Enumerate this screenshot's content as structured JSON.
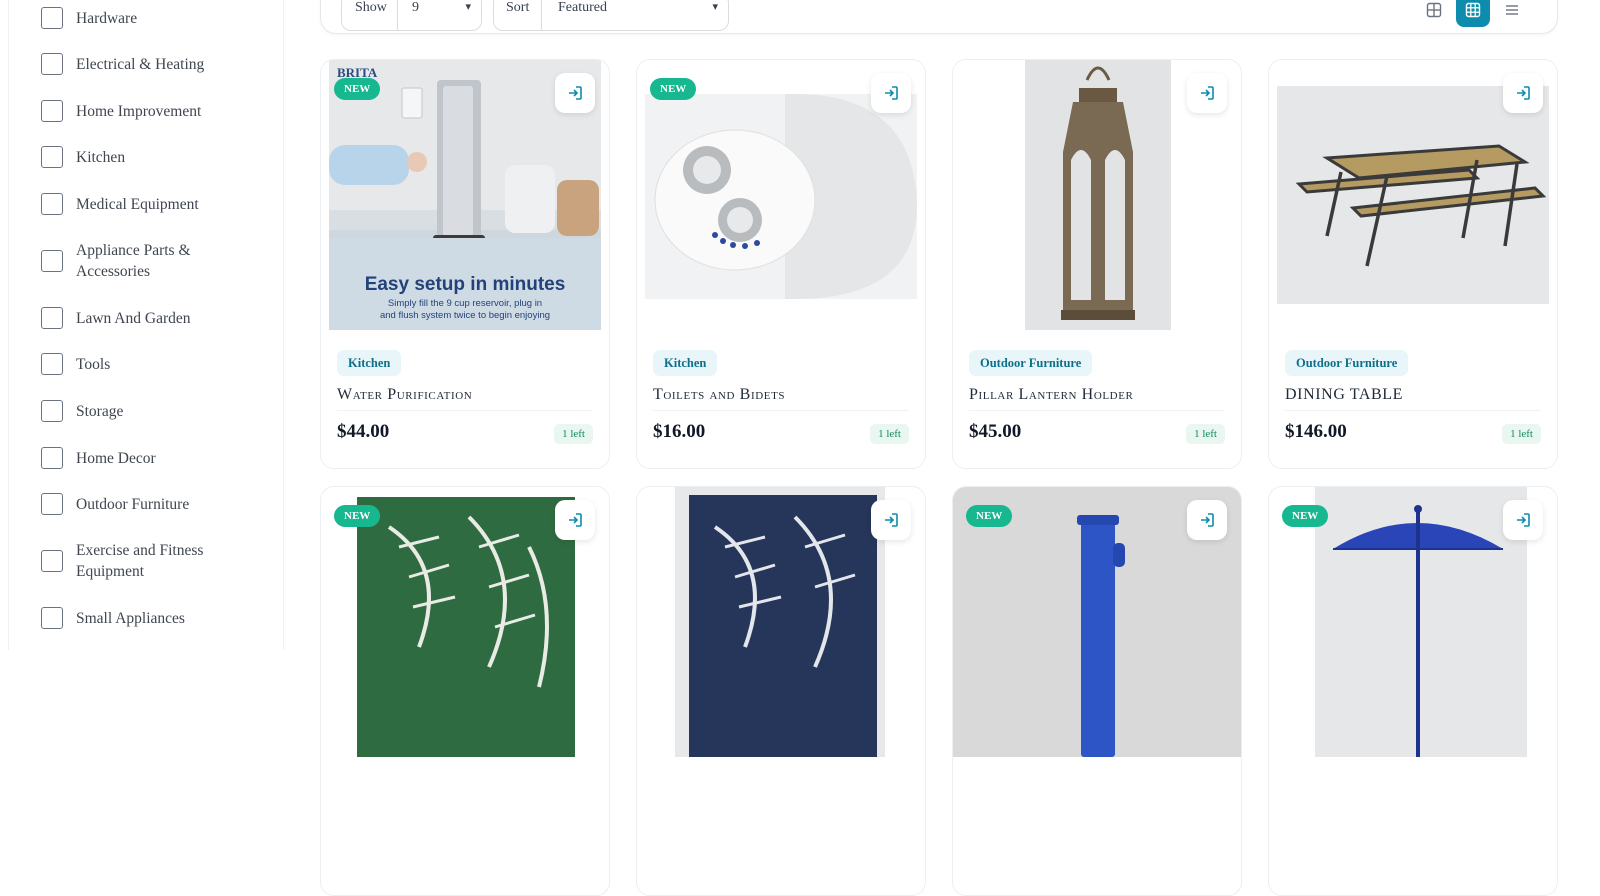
{
  "sidebar": {
    "categories": [
      {
        "label": "Hardware"
      },
      {
        "label": "Electrical & Heating"
      },
      {
        "label": "Home Improvement"
      },
      {
        "label": "Kitchen"
      },
      {
        "label": "Medical Equipment"
      },
      {
        "label": "Appliance Parts & Accessories"
      },
      {
        "label": "Lawn And Garden"
      },
      {
        "label": "Tools"
      },
      {
        "label": "Storage"
      },
      {
        "label": "Home Decor"
      },
      {
        "label": "Outdoor Furniture"
      },
      {
        "label": "Exercise and Fitness Equipment"
      },
      {
        "label": "Small Appliances"
      }
    ]
  },
  "toolbar": {
    "show_label": "Show",
    "show_value": "9",
    "sort_label": "Sort",
    "sort_value": "Featured"
  },
  "products": [
    {
      "badge": "NEW",
      "category": "Kitchen",
      "name": "Water Purification",
      "price": "$44.00",
      "stock": "1 left",
      "image_brand": "BRITA",
      "image_headline": "Easy setup in minutes",
      "image_sub1": "Simply fill the 9 cup reservoir, plug in",
      "image_sub2": "and flush system twice to begin enjoying"
    },
    {
      "badge": "NEW",
      "category": "Kitchen",
      "name": "Toilets and Bidets",
      "price": "$16.00",
      "stock": "1 left"
    },
    {
      "badge": "",
      "category": "Outdoor Furniture",
      "name": "Pillar Lantern Holder",
      "price": "$45.00",
      "stock": "1 left"
    },
    {
      "badge": "",
      "category": "Outdoor Furniture",
      "name": "DINING TABLE",
      "price": "$146.00",
      "stock": "1 left"
    },
    {
      "badge": "NEW"
    },
    {
      "badge": ""
    },
    {
      "badge": "NEW"
    },
    {
      "badge": "NEW"
    }
  ],
  "colors": {
    "accent": "#0d8cad",
    "new_badge": "#17b890",
    "category_pill_bg": "#e8f5f9",
    "stock_bg": "#eaf7f1"
  },
  "icons": {
    "enter": "enter-icon",
    "grid": "grid-icon",
    "list": "list-icon"
  }
}
